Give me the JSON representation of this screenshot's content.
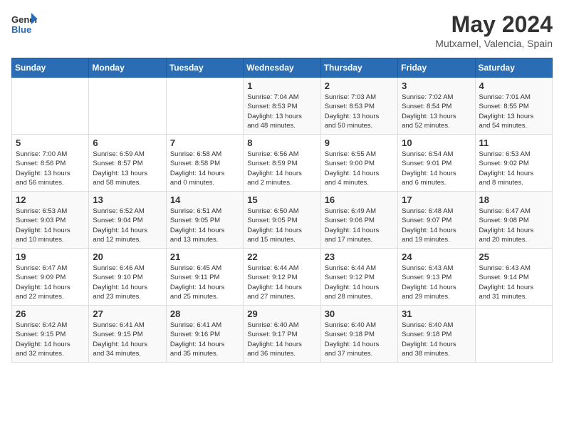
{
  "logo": {
    "general": "General",
    "blue": "Blue"
  },
  "title": "May 2024",
  "location": "Mutxamel, Valencia, Spain",
  "days_of_week": [
    "Sunday",
    "Monday",
    "Tuesday",
    "Wednesday",
    "Thursday",
    "Friday",
    "Saturday"
  ],
  "weeks": [
    [
      {
        "day": "",
        "info": ""
      },
      {
        "day": "",
        "info": ""
      },
      {
        "day": "",
        "info": ""
      },
      {
        "day": "1",
        "info": "Sunrise: 7:04 AM\nSunset: 8:53 PM\nDaylight: 13 hours\nand 48 minutes."
      },
      {
        "day": "2",
        "info": "Sunrise: 7:03 AM\nSunset: 8:53 PM\nDaylight: 13 hours\nand 50 minutes."
      },
      {
        "day": "3",
        "info": "Sunrise: 7:02 AM\nSunset: 8:54 PM\nDaylight: 13 hours\nand 52 minutes."
      },
      {
        "day": "4",
        "info": "Sunrise: 7:01 AM\nSunset: 8:55 PM\nDaylight: 13 hours\nand 54 minutes."
      }
    ],
    [
      {
        "day": "5",
        "info": "Sunrise: 7:00 AM\nSunset: 8:56 PM\nDaylight: 13 hours\nand 56 minutes."
      },
      {
        "day": "6",
        "info": "Sunrise: 6:59 AM\nSunset: 8:57 PM\nDaylight: 13 hours\nand 58 minutes."
      },
      {
        "day": "7",
        "info": "Sunrise: 6:58 AM\nSunset: 8:58 PM\nDaylight: 14 hours\nand 0 minutes."
      },
      {
        "day": "8",
        "info": "Sunrise: 6:56 AM\nSunset: 8:59 PM\nDaylight: 14 hours\nand 2 minutes."
      },
      {
        "day": "9",
        "info": "Sunrise: 6:55 AM\nSunset: 9:00 PM\nDaylight: 14 hours\nand 4 minutes."
      },
      {
        "day": "10",
        "info": "Sunrise: 6:54 AM\nSunset: 9:01 PM\nDaylight: 14 hours\nand 6 minutes."
      },
      {
        "day": "11",
        "info": "Sunrise: 6:53 AM\nSunset: 9:02 PM\nDaylight: 14 hours\nand 8 minutes."
      }
    ],
    [
      {
        "day": "12",
        "info": "Sunrise: 6:53 AM\nSunset: 9:03 PM\nDaylight: 14 hours\nand 10 minutes."
      },
      {
        "day": "13",
        "info": "Sunrise: 6:52 AM\nSunset: 9:04 PM\nDaylight: 14 hours\nand 12 minutes."
      },
      {
        "day": "14",
        "info": "Sunrise: 6:51 AM\nSunset: 9:05 PM\nDaylight: 14 hours\nand 13 minutes."
      },
      {
        "day": "15",
        "info": "Sunrise: 6:50 AM\nSunset: 9:05 PM\nDaylight: 14 hours\nand 15 minutes."
      },
      {
        "day": "16",
        "info": "Sunrise: 6:49 AM\nSunset: 9:06 PM\nDaylight: 14 hours\nand 17 minutes."
      },
      {
        "day": "17",
        "info": "Sunrise: 6:48 AM\nSunset: 9:07 PM\nDaylight: 14 hours\nand 19 minutes."
      },
      {
        "day": "18",
        "info": "Sunrise: 6:47 AM\nSunset: 9:08 PM\nDaylight: 14 hours\nand 20 minutes."
      }
    ],
    [
      {
        "day": "19",
        "info": "Sunrise: 6:47 AM\nSunset: 9:09 PM\nDaylight: 14 hours\nand 22 minutes."
      },
      {
        "day": "20",
        "info": "Sunrise: 6:46 AM\nSunset: 9:10 PM\nDaylight: 14 hours\nand 23 minutes."
      },
      {
        "day": "21",
        "info": "Sunrise: 6:45 AM\nSunset: 9:11 PM\nDaylight: 14 hours\nand 25 minutes."
      },
      {
        "day": "22",
        "info": "Sunrise: 6:44 AM\nSunset: 9:12 PM\nDaylight: 14 hours\nand 27 minutes."
      },
      {
        "day": "23",
        "info": "Sunrise: 6:44 AM\nSunset: 9:12 PM\nDaylight: 14 hours\nand 28 minutes."
      },
      {
        "day": "24",
        "info": "Sunrise: 6:43 AM\nSunset: 9:13 PM\nDaylight: 14 hours\nand 29 minutes."
      },
      {
        "day": "25",
        "info": "Sunrise: 6:43 AM\nSunset: 9:14 PM\nDaylight: 14 hours\nand 31 minutes."
      }
    ],
    [
      {
        "day": "26",
        "info": "Sunrise: 6:42 AM\nSunset: 9:15 PM\nDaylight: 14 hours\nand 32 minutes."
      },
      {
        "day": "27",
        "info": "Sunrise: 6:41 AM\nSunset: 9:15 PM\nDaylight: 14 hours\nand 34 minutes."
      },
      {
        "day": "28",
        "info": "Sunrise: 6:41 AM\nSunset: 9:16 PM\nDaylight: 14 hours\nand 35 minutes."
      },
      {
        "day": "29",
        "info": "Sunrise: 6:40 AM\nSunset: 9:17 PM\nDaylight: 14 hours\nand 36 minutes."
      },
      {
        "day": "30",
        "info": "Sunrise: 6:40 AM\nSunset: 9:18 PM\nDaylight: 14 hours\nand 37 minutes."
      },
      {
        "day": "31",
        "info": "Sunrise: 6:40 AM\nSunset: 9:18 PM\nDaylight: 14 hours\nand 38 minutes."
      },
      {
        "day": "",
        "info": ""
      }
    ]
  ]
}
